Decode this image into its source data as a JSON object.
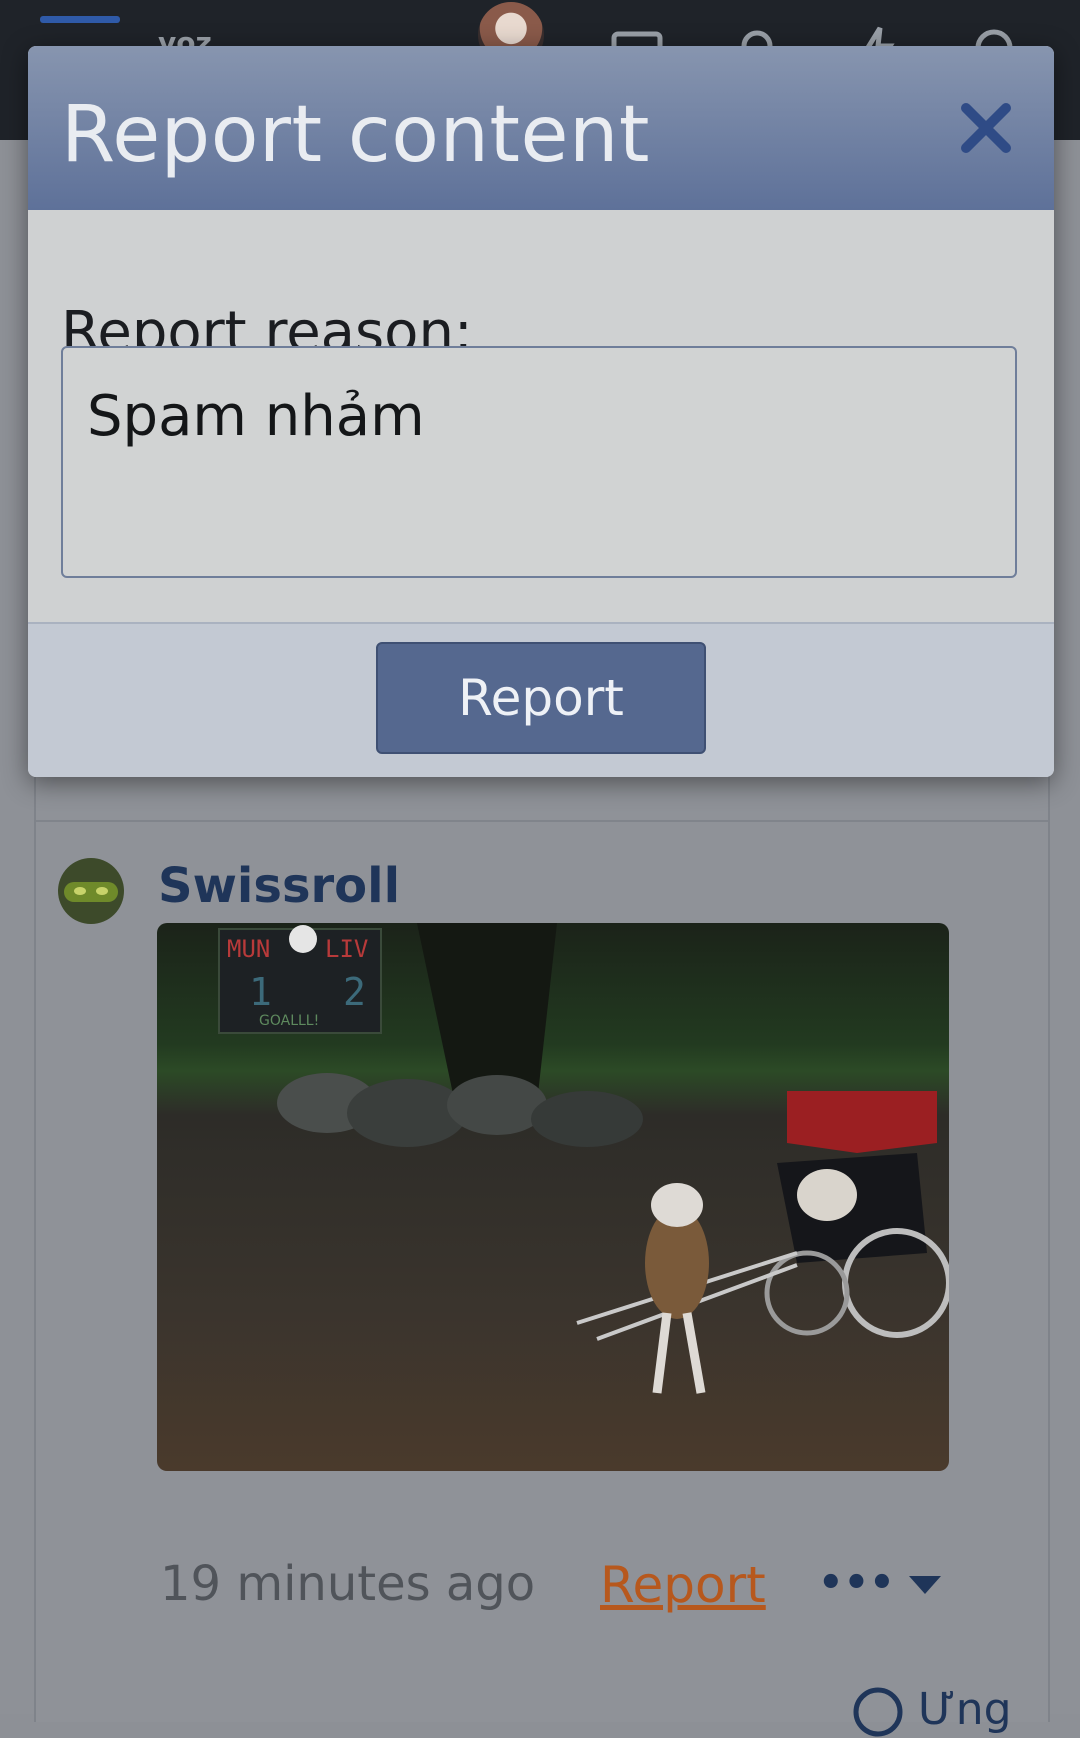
{
  "topbar": {
    "logo_text": "voz"
  },
  "modal": {
    "title": "Report content",
    "close_label": "✕",
    "reason_label": "Report reason:",
    "reason_value": "Spam nhảm",
    "submit_label": "Report"
  },
  "post": {
    "username": "Swissroll",
    "timestamp": "19 minutes ago",
    "report_link": "Report",
    "more_label": "•••",
    "reply_label": "Ưng"
  },
  "colors": {
    "accent": "#55688f",
    "header_gradient_top": "#8795af",
    "header_gradient_bottom": "#5e7199",
    "report_link": "#b7581d",
    "username": "#1f3559"
  },
  "image_scoreboard": {
    "home": "MUN",
    "away": "LIV",
    "home_score": "1",
    "away_score": "2",
    "caption": "GOALLL!"
  }
}
